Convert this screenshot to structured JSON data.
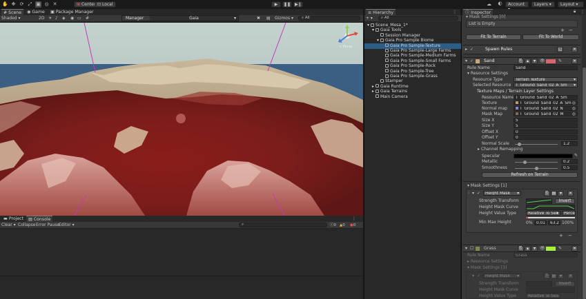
{
  "toolbar": {
    "pivot_center": "Center",
    "pivot_local": "Local",
    "account": "Account",
    "layers": "Layers",
    "layout": "Layout"
  },
  "scene_view": {
    "tabs": [
      "Scene",
      "Game",
      "Package Manager"
    ],
    "shading": "Shaded",
    "mode_2d": "2D",
    "gizmos": "Gizmos",
    "search_all": "All",
    "overlay_label": "Manager",
    "overlay_value": "Gaia",
    "gizmo_persp": "< Persp"
  },
  "console": {
    "tabs": [
      "Project",
      "Console"
    ],
    "clear": "Clear",
    "collapse": "Collapse",
    "error_pause": "Error Pause",
    "editor": "Editor",
    "counts": [
      "0",
      "0",
      "0"
    ]
  },
  "hierarchy": {
    "tab": "Hierarchy",
    "add": "+ ▾",
    "search_all": "All",
    "items": [
      {
        "label": "Scene_Mesa_1*",
        "indent": 0,
        "arrow": "▾",
        "kind": "scene"
      },
      {
        "label": "Gaia Tools",
        "indent": 1,
        "arrow": "▾",
        "kind": "go"
      },
      {
        "label": "Session Manager",
        "indent": 2,
        "arrow": "",
        "kind": "go"
      },
      {
        "label": "Gaia Pro Sample Biome",
        "indent": 2,
        "arrow": "▾",
        "kind": "go"
      },
      {
        "label": "Gaia Pro Sample-Texture",
        "indent": 3,
        "arrow": "",
        "kind": "go",
        "selected": true
      },
      {
        "label": "Gaia Pro Sample-Large Farms",
        "indent": 3,
        "arrow": "",
        "kind": "go"
      },
      {
        "label": "Gaia Pro Sample-Medium Farms",
        "indent": 3,
        "arrow": "",
        "kind": "go"
      },
      {
        "label": "Gaia Pro Sample-Small Farms",
        "indent": 3,
        "arrow": "",
        "kind": "go"
      },
      {
        "label": "Gaia Pro Sample-Rock",
        "indent": 3,
        "arrow": "",
        "kind": "go"
      },
      {
        "label": "Gaia Pro Sample-Tree",
        "indent": 3,
        "arrow": "",
        "kind": "go"
      },
      {
        "label": "Gaia Pro Sample-Grass",
        "indent": 3,
        "arrow": "",
        "kind": "go"
      },
      {
        "label": "Stamper",
        "indent": 2,
        "arrow": "",
        "kind": "go"
      },
      {
        "label": "Gaia Runtime",
        "indent": 1,
        "arrow": "▸",
        "kind": "go"
      },
      {
        "label": "Gaia Terrains",
        "indent": 1,
        "arrow": "▸",
        "kind": "go"
      },
      {
        "label": "Main Camera",
        "indent": 1,
        "arrow": "",
        "kind": "go"
      }
    ]
  },
  "inspector": {
    "tab": "Inspector",
    "mask_settings_top": "Mask Settings [0]",
    "list_empty": "List is Empty",
    "fit_terrain": "Fit To Terrain",
    "fit_world": "Fit To World",
    "spawn_rules": "Spawn Rules",
    "rule1": {
      "name": "Sand",
      "rule_name_label": "Rule Name",
      "rule_name_value": "Sand",
      "resource_settings": "Resource Settings",
      "resource_type_label": "Resource Type",
      "resource_type_value": "Terrain Texture",
      "selected_resource_label": "Selected Resource",
      "selected_resource_value": "T_Ground_Sand_02_A_Sm",
      "texture_maps_header": "Texture Maps / Terrain Layer Settings",
      "resource_name_label": "Resource Name",
      "resource_name_value": "T_Ground_Sand_02_A_Sm",
      "texture_label": "Texture",
      "texture_value": "T_Ground_Sand_02_A_Sm",
      "normal_label": "Normal map",
      "normal_value": "T_Ground_Sand_02_N",
      "mask_label": "Mask Map",
      "mask_value": "T_Ground_Sand_02_M",
      "size_x_label": "Size X",
      "size_x_value": "5",
      "size_y_label": "Size Y",
      "size_y_value": "5",
      "offset_x_label": "Offset X",
      "offset_x_value": "0",
      "offset_y_label": "Offset Y",
      "offset_y_value": "0",
      "normal_scale_label": "Normal Scale",
      "normal_scale_value": "1.2",
      "channel_remap": "Channel Remapping",
      "specular_label": "Specular",
      "metallic_label": "Metallic",
      "metallic_value": "0.2",
      "smoothness_label": "Smoothness",
      "smoothness_value": "0.5",
      "refresh": "Refresh on Terrain"
    },
    "mask_settings_1": "Mask Settings [1]",
    "height_mask": {
      "title": "Height Mask",
      "strength_label": "Strength Transform",
      "invert": "Invert",
      "curve_label": "Height Mask Curve",
      "value_type_label": "Height Value Type",
      "value_type_value": "Relative To Sea",
      "value_type_unit": "Perce",
      "min_max_label": "Min Max Height",
      "min_max_values": [
        "0%",
        "0.01",
        "63.2",
        "100%"
      ]
    },
    "rule2": {
      "name": "Grass",
      "rule_name_label": "Rule Name",
      "rule_name_value": "Grass",
      "resource_settings": "Resource Settings",
      "mask_settings": "Mask Settings [3]",
      "height_mask_title": "Height Mask",
      "strength_label": "Strength Transform",
      "invert": "Invert",
      "curve_label": "Height Mask Curve",
      "value_type_label": "Height Value Type",
      "value_type_value": "Relative To Sea"
    },
    "colors": {
      "sand_swatch": "#d8666e",
      "grass_swatch": "#a7ef3d"
    }
  }
}
